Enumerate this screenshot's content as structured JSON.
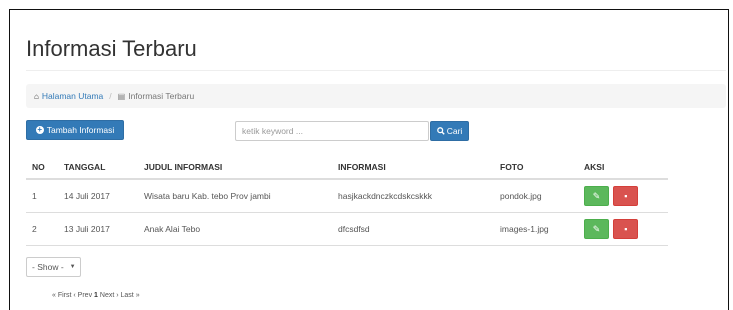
{
  "page": {
    "title": "Informasi Terbaru"
  },
  "breadcrumb": {
    "home_icon": "home-icon",
    "home_label": "Halaman Utama",
    "separator": "/",
    "current_icon": "file-icon",
    "current_label": "Informasi Terbaru"
  },
  "toolbar": {
    "add_label": "Tambah Informasi",
    "search_placeholder": "ketik keyword ...",
    "search_button_label": "Cari",
    "primary_color": "#337ab7"
  },
  "table": {
    "headers": [
      "NO",
      "TANGGAL",
      "JUDUL INFORMASI",
      "INFORMASI",
      "FOTO",
      "AKSI"
    ],
    "rows": [
      {
        "no": "1",
        "tanggal": "14 Juli 2017",
        "judul": "Wisata baru Kab. tebo Prov jambi",
        "informasi": "hasjkackdnczkcdskcskkk",
        "foto": "pondok.jpg"
      },
      {
        "no": "2",
        "tanggal": "13 Juli 2017",
        "judul": "Anak Alai Tebo",
        "informasi": "dfcsdfsd",
        "foto": "images-1.jpg"
      }
    ],
    "edit_color": "#5cb85c",
    "delete_color": "#d9534f"
  },
  "show": {
    "selected": "- Show -"
  },
  "pagination": {
    "first": "« First",
    "prev": "‹ Prev",
    "current": "1",
    "next": "Next ›",
    "last": "Last »"
  }
}
